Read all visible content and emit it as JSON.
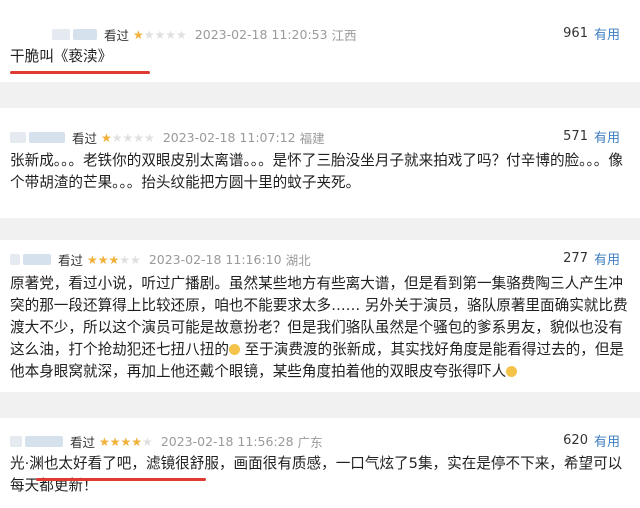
{
  "reviews": [
    {
      "status": "看过",
      "rating": 1,
      "time": "2023-02-18 11:20:53",
      "region": "江西",
      "votes": "961",
      "useful_label": "有用",
      "content": "干脆叫《亵渎》"
    },
    {
      "status": "看过",
      "rating": 1,
      "time": "2023-02-18 11:07:12",
      "region": "福建",
      "votes": "571",
      "useful_label": "有用",
      "content": "张新成。。。老铁你的双眼皮别太离谱。。。是怀了三胎没坐月子就来拍戏了吗？付辛博的脸。。。像个带胡渣的芒果。。。抬头纹能把方圆十里的蚊子夹死。"
    },
    {
      "status": "看过",
      "rating": 3,
      "time": "2023-02-18 11:16:10",
      "region": "湖北",
      "votes": "277",
      "useful_label": "有用",
      "content_a": "原著党，看过小说，听过广播剧。虽然某些地方有些离大谱，但是看到第一集骆费陶三人产生冲突的那一段还算得上比较还原，咱也不能要求太多…… 另外关于演员，骆队原著里面确实就比费渡大不少，所以这个演员可能是故意扮老？但是我们骆队虽然是个骚包的爹系男友，貌似也没有这么油，打个抢劫犯还七扭八扭的",
      "content_b": " 至于演费渡的张新成，其实找好角度是能看得过去的，但是他本身眼窝就深，再加上他还戴个眼镜，某些角度拍着他的双眼皮夸张得吓人"
    },
    {
      "status": "看过",
      "rating": 4,
      "time": "2023-02-18 11:56:28",
      "region": "广东",
      "votes": "620",
      "useful_label": "有用",
      "content": "光·渊也太好看了吧，滤镜很舒服，画面很有质感，一口气炫了5集，实在是停不下来，希望可以每天都更新！"
    }
  ],
  "colors": {
    "star": "#f2b23a",
    "star_empty": "#e0e0e0",
    "useful": "#3d7dc1",
    "underline": "#e03b32"
  }
}
